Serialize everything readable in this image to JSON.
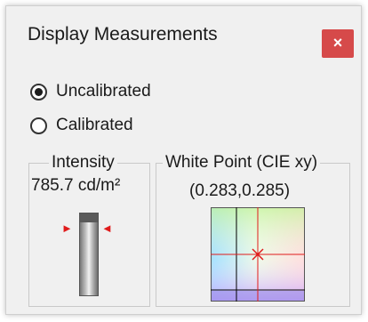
{
  "window": {
    "title": "Display Measurements",
    "close_symbol": "×"
  },
  "mode": {
    "options": [
      {
        "label": "Uncalibrated",
        "selected": true
      },
      {
        "label": "Calibrated",
        "selected": false
      }
    ]
  },
  "intensity": {
    "label": "Intensity",
    "value": "785.7 cd/m²",
    "icon": "light-tube-icon",
    "arrow_color": "#e01b1b"
  },
  "white_point": {
    "label": "White Point (CIE xy)",
    "value": "(0.283,0.285)",
    "icon": "chromaticity-chart",
    "marker_color": "#e01b1b",
    "close_button_color": "#d64a4a"
  }
}
